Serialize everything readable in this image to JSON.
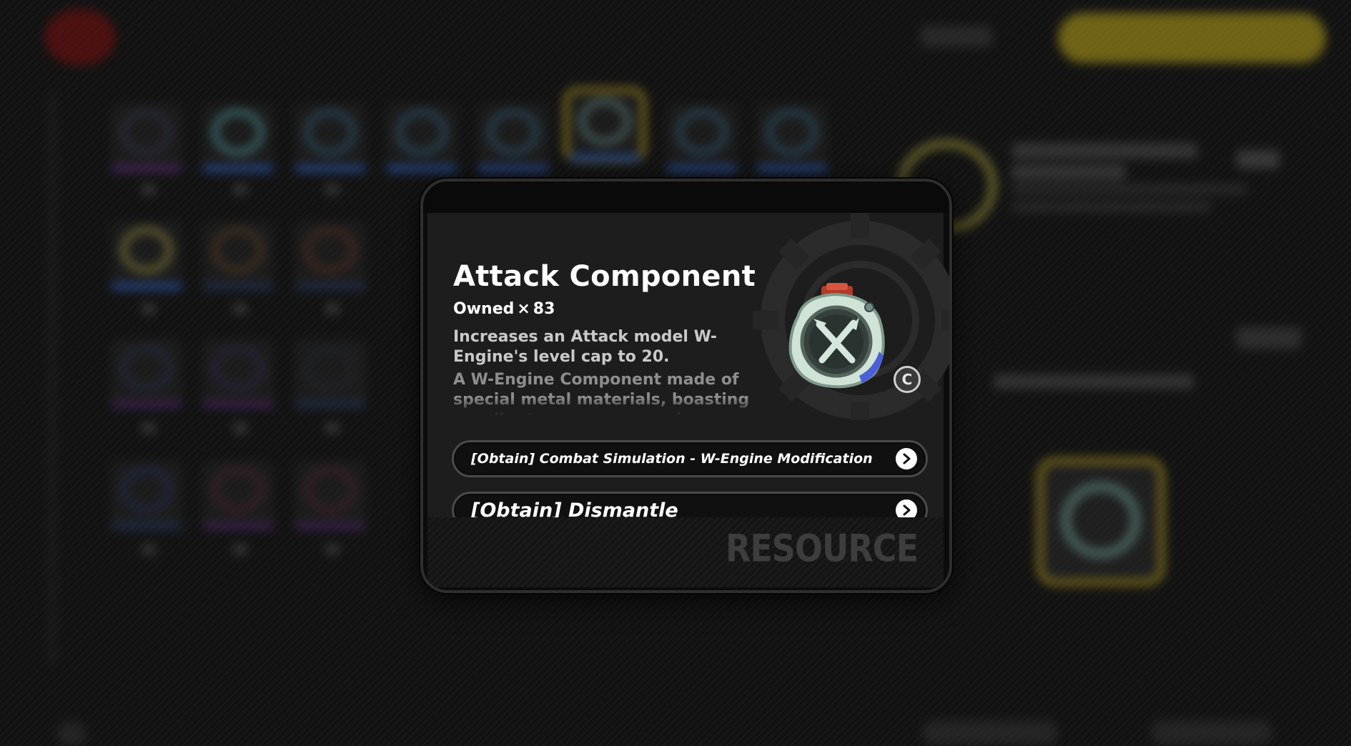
{
  "item": {
    "name": "Attack Component",
    "owned_label": "Owned",
    "owned_mult": "×",
    "owned_count": "83",
    "effect": "Increases an Attack model W-Engine's level cap to 20.",
    "lore": "A W-Engine Component made of special metal materials, boasting excellent energy conversion",
    "icon": "attack-component-icon",
    "rarity_symbol": "C"
  },
  "sources": [
    {
      "label": "[Obtain] Combat Simulation - W-Engine Modification",
      "icon": "chevron-right-icon"
    },
    {
      "label": "[Obtain] Dismantle",
      "icon": "chevron-right-icon"
    }
  ],
  "footer": {
    "watermark": "RESOURCE"
  },
  "colors": {
    "modal_bg": "#1d1d1d",
    "text_primary": "#ffffff",
    "text_secondary": "#c9c9c9",
    "text_muted": "#8e8e8e",
    "accent_yellow": "#c9ad24"
  }
}
